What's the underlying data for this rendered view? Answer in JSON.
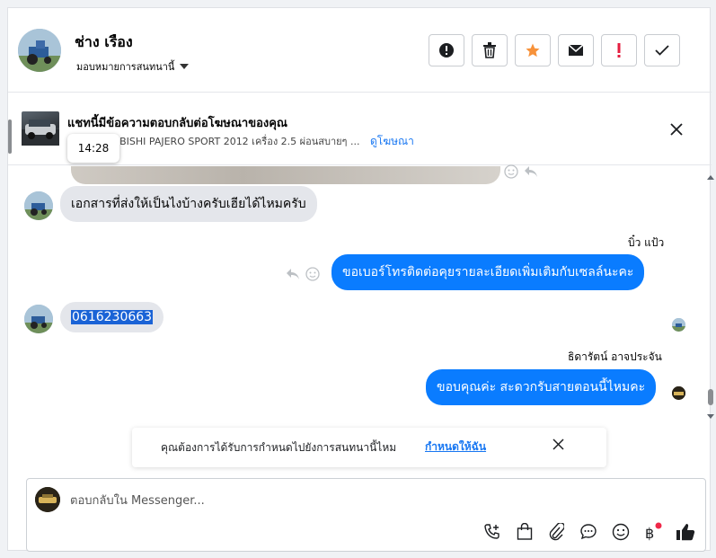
{
  "header": {
    "contact_name": "ช่าง เรือง",
    "assign_label": "มอบหมายการสนทนานี้",
    "actions": [
      {
        "name": "mark-spam",
        "icon": "alert-circle-icon"
      },
      {
        "name": "delete",
        "icon": "trash-icon"
      },
      {
        "name": "star",
        "icon": "star-icon",
        "color": "#f7923a"
      },
      {
        "name": "mark-unread",
        "icon": "envelope-icon"
      },
      {
        "name": "follow-up",
        "icon": "exclamation-icon",
        "color": "#e41e3f"
      },
      {
        "name": "mark-done",
        "icon": "check-icon"
      }
    ]
  },
  "ad": {
    "title": "แชทนี้มีข้อความตอบกลับต่อโฆษณาของคุณ",
    "description": "ที่นั่ง MITSUBISHI PAJERO SPORT 2012 เครื่อง 2.5 ผ่อนสบายๆ ...",
    "link_label": "ดูโฆษณา"
  },
  "tooltip_time": "14:28",
  "messages": [
    {
      "direction": "in",
      "text": "เอกสารที่ส่งให้เป็นไงบ้างครับเฮียได้ไหมครับ"
    },
    {
      "direction": "out",
      "sender": "บิ๋ว แป้ว",
      "text": "ขอเบอร์โทรติดต่อคุยรายละเอียดเพิ่มเติมกับเซลล์นะคะ"
    },
    {
      "direction": "in",
      "text": "0616230663",
      "selected": true
    },
    {
      "direction": "out",
      "sender": "ธิดารัตน์ อาจประจัน",
      "text": "ขอบคุณค่ะ สะดวกรับสายตอนนี้ไหมคะ"
    }
  ],
  "suggestion": {
    "text": "คุณต้องการได้รับการกำหนดไปยังการสนทนานี้ไหม",
    "link_label": "กำหนดให้ฉัน"
  },
  "composer": {
    "placeholder": "ตอบกลับใน Messenger...",
    "icons": [
      "phone-add-icon",
      "shopping-bag-icon",
      "paperclip-icon",
      "saved-reply-icon",
      "emoji-icon",
      "baht-payment-icon",
      "thumbs-up-icon"
    ],
    "accent": "#1877f2",
    "badge_color": "#f02849"
  }
}
